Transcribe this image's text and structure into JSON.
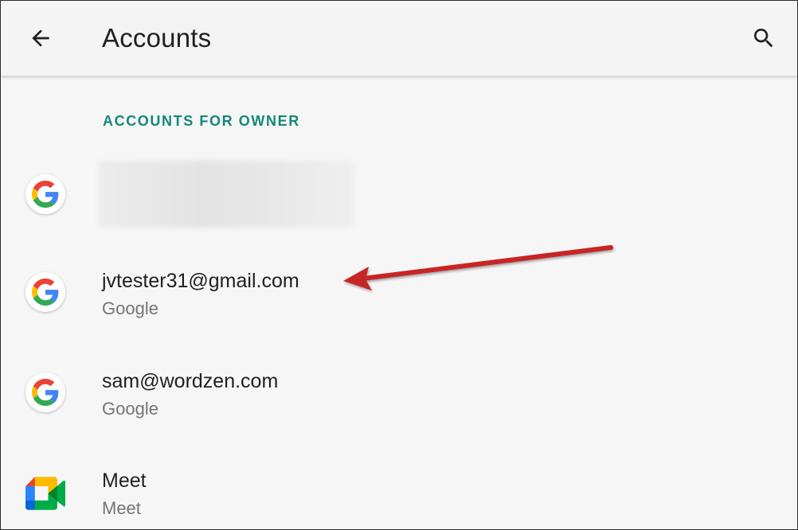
{
  "appbar": {
    "title": "Accounts",
    "back_icon": "arrow-back-icon",
    "search_icon": "search-icon"
  },
  "section": {
    "header": "ACCOUNTS FOR OWNER",
    "header_color": "#15877a"
  },
  "accounts": [
    {
      "email": "",
      "type": "",
      "icon": "google-g-icon",
      "redacted": true
    },
    {
      "email": "jvtester31@gmail.com",
      "type": "Google",
      "icon": "google-g-icon"
    },
    {
      "email": "sam@wordzen.com",
      "type": "Google",
      "icon": "google-g-icon"
    },
    {
      "email": "Meet",
      "type": "Meet",
      "icon": "google-meet-icon"
    }
  ],
  "annotation": {
    "arrow_color": "#c62828",
    "target": "jvtester31@gmail.com"
  }
}
